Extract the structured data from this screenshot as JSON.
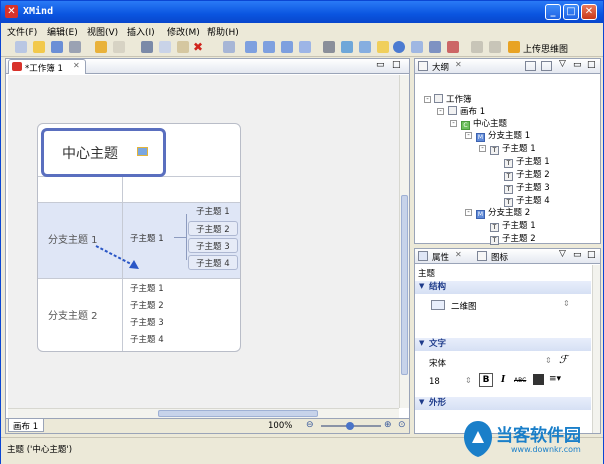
{
  "window": {
    "title": "XMind"
  },
  "menu": [
    "文件(F)",
    "编辑(E)",
    "视图(V)",
    "插入(I)",
    "修改(M)",
    "帮助(H)"
  ],
  "toolbar": {
    "upload_label": "上传思维图"
  },
  "editor": {
    "tab_label": "*工作簿 1",
    "sheet_tab": "画布 1",
    "zoom": "100%",
    "central_topic": "中心主题",
    "branch1": "分支主题 1",
    "branch2": "分支主题 2",
    "sub_mid": "子主题 1",
    "branch1_subs": [
      "子主题 1",
      "子主题 2",
      "子主题 3",
      "子主题 4"
    ],
    "branch2_subs": [
      "子主题 1",
      "子主题 2",
      "子主题 3",
      "子主题 4"
    ]
  },
  "outline": {
    "tab_label": "大纲",
    "items": [
      "工作簿",
      "画布 1",
      "中心主题",
      "分支主题 1",
      "子主题 1",
      "子主题 1",
      "子主题 2",
      "子主题 3",
      "子主题 4",
      "分支主题 2",
      "子主题 1",
      "子主题 2"
    ]
  },
  "properties": {
    "tab_label": "属性",
    "tab2_label": "图标",
    "heading": "主题",
    "section_structure": "结构",
    "structure_value": "二维图",
    "section_text": "文字",
    "font_name": "宋体",
    "font_size": "18",
    "section_shape": "外形"
  },
  "status": {
    "text": "主题 ('中心主题')"
  },
  "watermark": {
    "brand": "当客软件园",
    "url": "www.downkr.com"
  },
  "colors": {
    "titlebar": "#0a55e0",
    "central_border": "#5a6fbf",
    "branch_highlight": "#dfe6f6",
    "accent": "#1e3b8a"
  }
}
